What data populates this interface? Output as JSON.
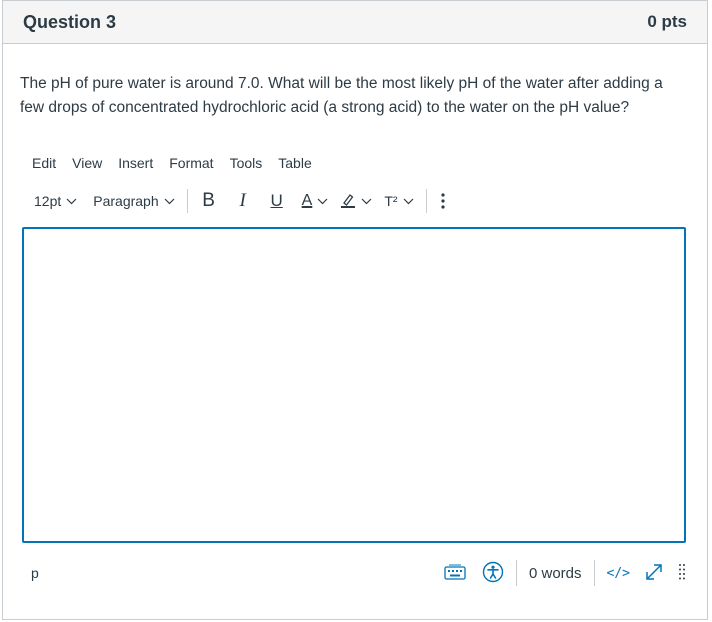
{
  "question": {
    "title": "Question 3",
    "points": "0 pts",
    "text": "The pH of pure water is around 7.0. What will be the most likely pH of the water after adding a few drops of concentrated hydrochloric acid (a strong acid) to the water on the pH value?"
  },
  "editor": {
    "menu": [
      "Edit",
      "View",
      "Insert",
      "Format",
      "Tools",
      "Table"
    ],
    "font_size": "12pt",
    "block_format": "Paragraph",
    "bold_label": "B",
    "italic_label": "I",
    "underline_label": "U",
    "text_color_label": "A",
    "superscript_label": "T²",
    "content": "",
    "status_path": "p",
    "word_count": "0 words",
    "html_view_label": "</>"
  },
  "colors": {
    "accent": "#0374b5",
    "text": "#2d3b45",
    "border": "#c7cdd1",
    "header_bg": "#f5f5f5"
  },
  "icons": [
    "chevron-down-icon",
    "highlight-color-icon",
    "more-options-icon",
    "keyboard-icon",
    "accessibility-icon",
    "fullscreen-icon",
    "resize-handle-icon"
  ]
}
